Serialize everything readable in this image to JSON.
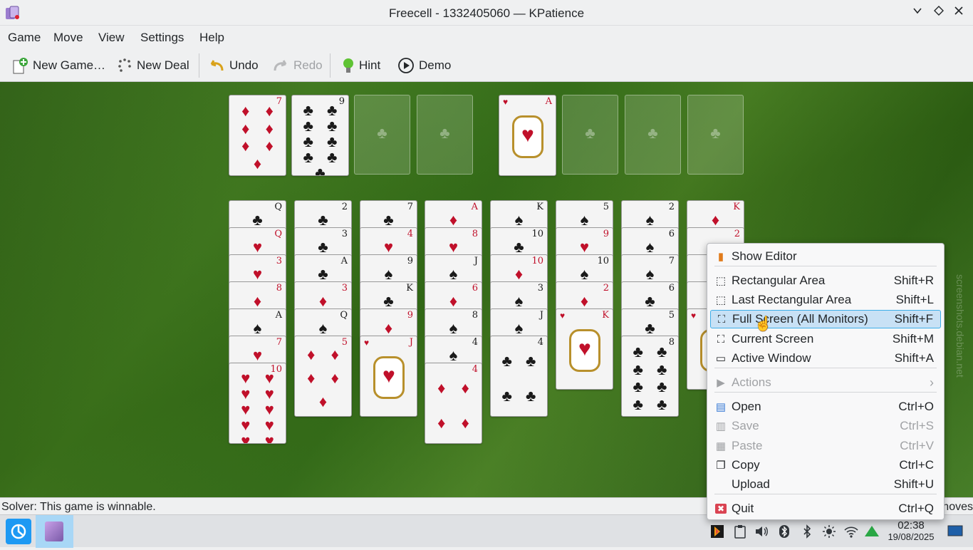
{
  "window": {
    "title": "Freecell - 1332405060 — KPatience",
    "min_icon": "chevron-down-icon",
    "max_icon": "diamond-icon",
    "close_icon": "close-icon"
  },
  "menu": [
    "Game",
    "Move",
    "View",
    "Settings",
    "Help"
  ],
  "toolbar": {
    "new_game": "New Game…",
    "new_deal": "New Deal",
    "undo": "Undo",
    "redo": "Redo",
    "hint": "Hint",
    "demo": "Demo"
  },
  "freecells": [
    {
      "rank": "7",
      "suit": "♦",
      "color": "red"
    },
    {
      "rank": "9",
      "suit": "♣",
      "color": "black"
    },
    null,
    null
  ],
  "foundations": [
    {
      "rank": "A",
      "suit": "♥",
      "color": "red"
    },
    null,
    null,
    null
  ],
  "columns": [
    [
      {
        "rank": "Q",
        "suit": "♣"
      },
      {
        "rank": "Q",
        "suit": "♥"
      },
      {
        "rank": "3",
        "suit": "♥"
      },
      {
        "rank": "8",
        "suit": "♦"
      },
      {
        "rank": "A",
        "suit": "♠"
      },
      {
        "rank": "7",
        "suit": "♥"
      },
      {
        "rank": "10",
        "suit": "♥"
      }
    ],
    [
      {
        "rank": "2",
        "suit": "♣"
      },
      {
        "rank": "3",
        "suit": "♣"
      },
      {
        "rank": "A",
        "suit": "♣"
      },
      {
        "rank": "3",
        "suit": "♦"
      },
      {
        "rank": "Q",
        "suit": "♠"
      },
      {
        "rank": "5",
        "suit": "♦"
      }
    ],
    [
      {
        "rank": "7",
        "suit": "♣"
      },
      {
        "rank": "4",
        "suit": "♥"
      },
      {
        "rank": "9",
        "suit": "♠"
      },
      {
        "rank": "K",
        "suit": "♣"
      },
      {
        "rank": "9",
        "suit": "♦"
      },
      {
        "rank": "J",
        "suit": "♥"
      }
    ],
    [
      {
        "rank": "A",
        "suit": "♦"
      },
      {
        "rank": "8",
        "suit": "♥"
      },
      {
        "rank": "J",
        "suit": "♠"
      },
      {
        "rank": "6",
        "suit": "♦"
      },
      {
        "rank": "8",
        "suit": "♠"
      },
      {
        "rank": "4",
        "suit": "♠"
      },
      {
        "rank": "4",
        "suit": "♦"
      }
    ],
    [
      {
        "rank": "K",
        "suit": "♠"
      },
      {
        "rank": "10",
        "suit": "♣"
      },
      {
        "rank": "10",
        "suit": "♦"
      },
      {
        "rank": "3",
        "suit": "♠"
      },
      {
        "rank": "J",
        "suit": "♠"
      },
      {
        "rank": "4",
        "suit": "♣"
      }
    ],
    [
      {
        "rank": "5",
        "suit": "♠"
      },
      {
        "rank": "9",
        "suit": "♥"
      },
      {
        "rank": "10",
        "suit": "♠"
      },
      {
        "rank": "2",
        "suit": "♦"
      },
      {
        "rank": "K",
        "suit": "♥"
      }
    ],
    [
      {
        "rank": "2",
        "suit": "♠"
      },
      {
        "rank": "6",
        "suit": "♠"
      },
      {
        "rank": "7",
        "suit": "♠"
      },
      {
        "rank": "6",
        "suit": "♣"
      },
      {
        "rank": "5",
        "suit": "♣"
      },
      {
        "rank": "8",
        "suit": "♣"
      }
    ],
    [
      {
        "rank": "K",
        "suit": "♦"
      },
      {
        "rank": "2",
        "suit": "♥"
      },
      {
        "rank": "",
        "suit": "♥"
      },
      {
        "rank": "",
        "suit": "♥"
      },
      {
        "rank": "",
        "suit": "♥"
      }
    ]
  ],
  "status": {
    "solver": "Solver: This game is winnable.",
    "right": "noves"
  },
  "context_menu": [
    {
      "icon": "editor-icon",
      "label": "Show Editor",
      "shortcut": ""
    },
    {
      "icon": "rect-area-icon",
      "label": "Rectangular Area",
      "shortcut": "Shift+R"
    },
    {
      "icon": "last-rect-icon",
      "label": "Last Rectangular Area",
      "shortcut": "Shift+L"
    },
    {
      "icon": "fullscreen-icon",
      "label": "Full Screen (All Monitors)",
      "shortcut": "Shift+F"
    },
    {
      "icon": "current-screen-icon",
      "label": "Current Screen",
      "shortcut": "Shift+M"
    },
    {
      "icon": "window-icon",
      "label": "Active Window",
      "shortcut": "Shift+A"
    },
    {
      "icon": "actions-icon",
      "label": "Actions",
      "shortcut": ""
    },
    {
      "icon": "open-icon",
      "label": "Open",
      "shortcut": "Ctrl+O"
    },
    {
      "icon": "save-icon",
      "label": "Save",
      "shortcut": "Ctrl+S"
    },
    {
      "icon": "paste-icon",
      "label": "Paste",
      "shortcut": "Ctrl+V"
    },
    {
      "icon": "copy-icon",
      "label": "Copy",
      "shortcut": "Ctrl+C"
    },
    {
      "icon": "",
      "label": "Upload",
      "shortcut": "Shift+U"
    },
    {
      "icon": "quit-icon",
      "label": "Quit",
      "shortcut": "Ctrl+Q"
    }
  ],
  "watermark": "screenshots.debian.net",
  "clock": {
    "time": "02:38",
    "date": "19/08/2025"
  }
}
